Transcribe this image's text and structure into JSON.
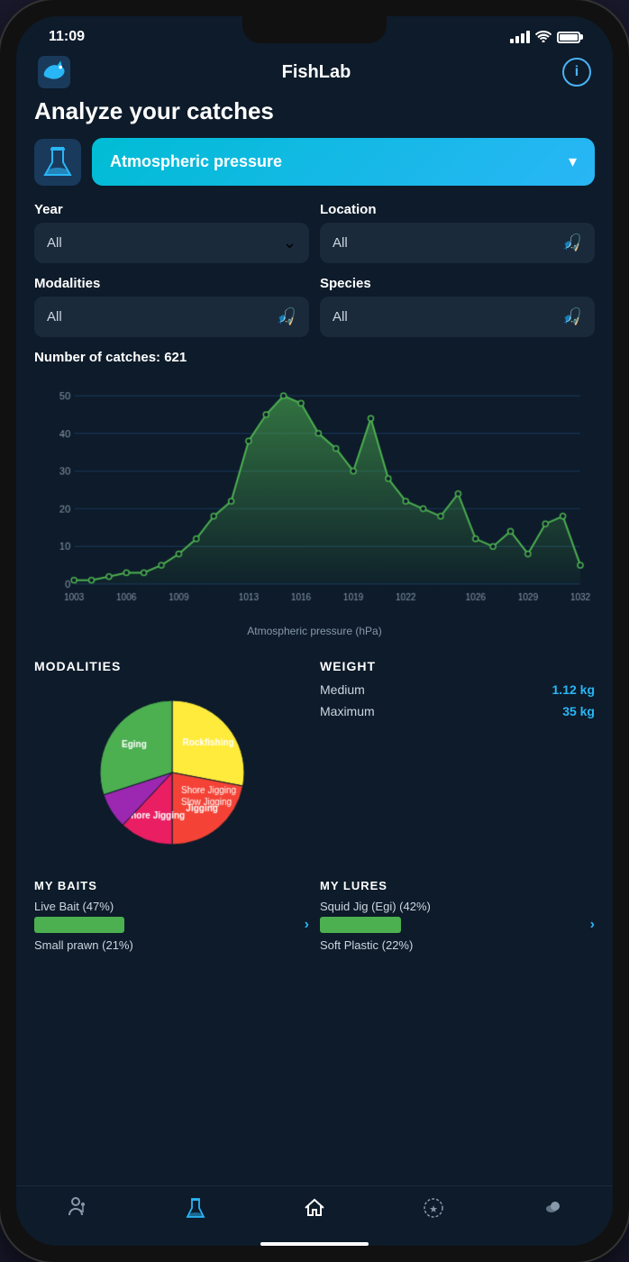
{
  "statusBar": {
    "time": "11:09"
  },
  "header": {
    "title": "FishLab",
    "infoLabel": "i"
  },
  "page": {
    "title": "Analyze your catches",
    "analysisSelectorLabel": "Atmospheric pressure",
    "yearLabel": "Year",
    "yearValue": "All",
    "locationLabel": "Location",
    "locationValue": "All",
    "modalitiesLabel": "Modalities",
    "modalitiesValue": "All",
    "speciesLabel": "Species",
    "speciesValue": "All",
    "catchesCount": "Number of catches: 621",
    "chartXLabel": "Atmospheric pressure (hPa)",
    "chartYLabels": [
      "0",
      "10",
      "20",
      "30",
      "40",
      "50"
    ],
    "chartXAxisLabels": [
      "1003",
      "1006",
      "1009",
      "1013",
      "1016",
      "1019",
      "1022",
      "1026",
      "1029",
      "1032"
    ],
    "modalities": {
      "sectionTitle": "MODALITIES",
      "segments": [
        {
          "label": "Rockfishing",
          "color": "#ffeb3b",
          "value": 28
        },
        {
          "label": "Jigging",
          "color": "#f44336",
          "value": 22
        },
        {
          "label": "Shore Jigging",
          "color": "#e91e63",
          "value": 12
        },
        {
          "label": "Slow Jigging",
          "color": "#9c27b0",
          "value": 8
        },
        {
          "label": "Eging",
          "color": "#4caf50",
          "value": 30
        }
      ]
    },
    "weight": {
      "sectionTitle": "WEIGHT",
      "mediumLabel": "Medium",
      "mediumValue": "1.12 kg",
      "maximumLabel": "Maximum",
      "maximumValue": "35 kg"
    },
    "baits": {
      "sectionTitle": "MY BAITS",
      "items": [
        {
          "label": "Live Bait (47%)",
          "barWidth": 80
        },
        {
          "label": "Small prawn (21%)",
          "barWidth": 40
        }
      ]
    },
    "lures": {
      "sectionTitle": "MY LURES",
      "items": [
        {
          "label": "Squid Jig (Egi) (42%)",
          "barWidth": 75
        },
        {
          "label": "Soft Plastic (22%)",
          "barWidth": 40
        }
      ]
    }
  },
  "bottomNav": {
    "items": [
      "angler",
      "flask",
      "home",
      "trophy",
      "weather"
    ]
  }
}
